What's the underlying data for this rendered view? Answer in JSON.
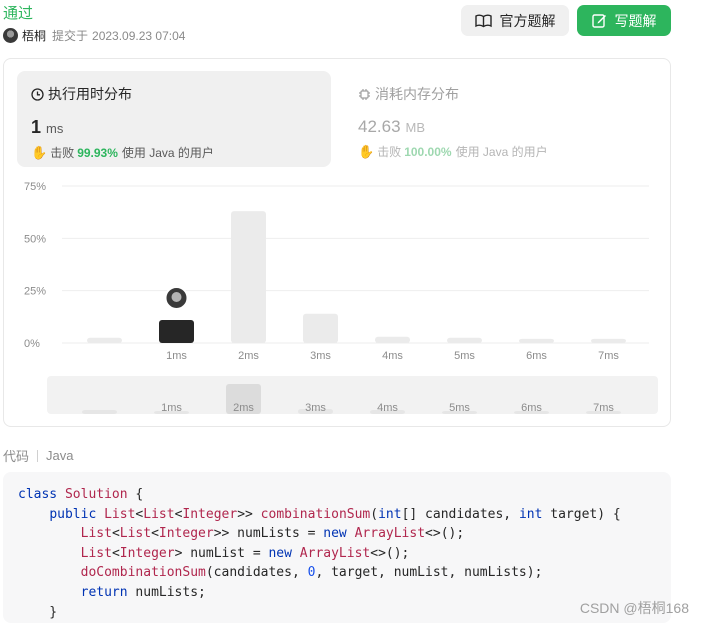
{
  "header": {
    "status": "通过",
    "username": "梧桐",
    "submitted_label": "提交于",
    "submitted_time": "2023.09.23 07:04",
    "official_solution_label": "官方题解",
    "write_solution_label": "写题解"
  },
  "runtime": {
    "title": "执行用时分布",
    "value": "1",
    "unit": "ms",
    "beat_prefix": "击败",
    "beat_pct": "99.93%",
    "beat_suffix": "使用 Java 的用户"
  },
  "memory": {
    "title": "消耗内存分布",
    "value": "42.63",
    "unit": "MB",
    "beat_prefix": "击败",
    "beat_pct": "100.00%",
    "beat_suffix": "使用 Java 的用户"
  },
  "chart_data": {
    "type": "bar",
    "categories": [
      "",
      "1ms",
      "2ms",
      "3ms",
      "4ms",
      "5ms",
      "6ms",
      "7ms"
    ],
    "values": [
      2.5,
      11,
      63,
      14,
      3,
      2.5,
      2,
      2
    ],
    "highlight_index": 1,
    "yticks": [
      "75%",
      "50%",
      "25%",
      "0%"
    ],
    "ytick_values": [
      75,
      50,
      25,
      0
    ],
    "ylim": [
      0,
      75
    ],
    "grid": true,
    "highlight_color": "#262626",
    "bar_color": "#ebebeb",
    "overview_values": [
      2,
      1.5,
      15,
      2.5,
      2,
      1.5,
      1.5,
      1.5
    ]
  },
  "code": {
    "label": "代码",
    "language": "Java",
    "lines": [
      [
        [
          "kw",
          "class "
        ],
        [
          "ty",
          "Solution "
        ],
        [
          "",
          "{"
        ]
      ],
      [
        [
          "",
          "    "
        ],
        [
          "kw",
          "public "
        ],
        [
          "ty",
          "List"
        ],
        [
          "",
          "<"
        ],
        [
          "ty",
          "List"
        ],
        [
          "",
          "<"
        ],
        [
          "ty",
          "Integer"
        ],
        [
          "",
          ">> "
        ],
        [
          "fn",
          "combinationSum"
        ],
        [
          "",
          "("
        ],
        [
          "kw",
          "int"
        ],
        [
          "",
          "[] candidates, "
        ],
        [
          "kw",
          "int "
        ],
        [
          "",
          "target) {"
        ]
      ],
      [
        [
          "",
          "        "
        ],
        [
          "ty",
          "List"
        ],
        [
          "",
          "<"
        ],
        [
          "ty",
          "List"
        ],
        [
          "",
          "<"
        ],
        [
          "ty",
          "Integer"
        ],
        [
          "",
          ">> numLists = "
        ],
        [
          "kw",
          "new "
        ],
        [
          "ty",
          "ArrayList"
        ],
        [
          "",
          "<>();"
        ]
      ],
      [
        [
          "",
          "        "
        ],
        [
          "ty",
          "List"
        ],
        [
          "",
          "<"
        ],
        [
          "ty",
          "Integer"
        ],
        [
          "",
          "> numList = "
        ],
        [
          "kw",
          "new "
        ],
        [
          "ty",
          "ArrayList"
        ],
        [
          "",
          "<>();"
        ]
      ],
      [
        [
          "",
          "        "
        ],
        [
          "fn",
          "doCombinationSum"
        ],
        [
          "",
          "(candidates, "
        ],
        [
          "num",
          "0"
        ],
        [
          "",
          ", target, numList, numLists);"
        ]
      ],
      [
        [
          "",
          "        "
        ],
        [
          "kw",
          "return "
        ],
        [
          "",
          "numLists;"
        ]
      ],
      [
        [
          "",
          "    }"
        ]
      ]
    ]
  },
  "watermark": "CSDN @梧桐168"
}
